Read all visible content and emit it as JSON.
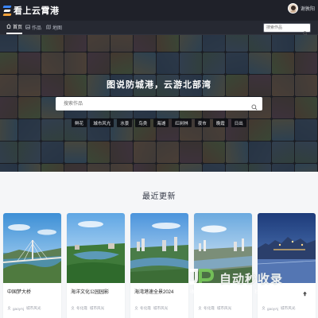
{
  "brand": {
    "name": "看上云霄港"
  },
  "user": {
    "name": "谢敦阳"
  },
  "nav": {
    "tabs": [
      {
        "label": "首页",
        "icon": "home-icon",
        "active": true
      },
      {
        "label": "作品",
        "icon": "image-icon",
        "active": false
      },
      {
        "label": "地图",
        "icon": "map-icon",
        "active": false
      }
    ],
    "search_placeholder": "搜索作品"
  },
  "hero": {
    "title": "图说防城港，云游北部湾",
    "search_placeholder": "搜索作品",
    "tags": [
      "鲜花",
      "城市风光",
      "水景",
      "鸟类",
      "海滩",
      "红树林",
      "夜市",
      "晚霞",
      "日出"
    ]
  },
  "section": {
    "title": "最近更新"
  },
  "cards": [
    {
      "title": "中国梦大桥",
      "author": "gaoyAj",
      "category": "城市风光"
    },
    {
      "title": "海洋文化公园园影",
      "author": "冬化霞",
      "category": "城市风光"
    },
    {
      "title": "海湾港速全景2024",
      "author": "冬化霞",
      "category": "城市风光"
    },
    {
      "title": "",
      "author": "冬化霞",
      "category": "城市风光"
    },
    {
      "title": "",
      "author": "gaoyAj",
      "category": "城市风光"
    }
  ],
  "watermark": {
    "main": "自动秒收录",
    "sub": "收 录 一 来 访 一 次 · 秒 动 收 录"
  },
  "colors": {
    "topbar": "#1f2129",
    "subnav": "#262932",
    "page_bg": "#f5f6f8",
    "accent_blue": "#3a86ff",
    "accent_orange": "#f4a23b"
  }
}
